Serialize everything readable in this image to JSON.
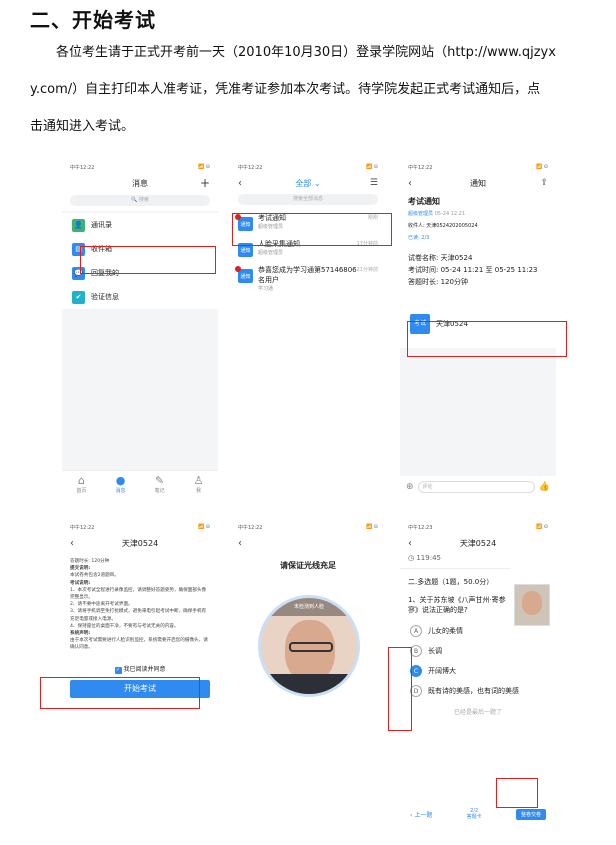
{
  "heading": "二、开始考试",
  "paragraph": {
    "line1": "各位考生请于正式开考前一天（2010年10月30日）登录学院网站（http://www.qjzyx",
    "line2": "y.com/）自主打印本人准考证，凭准考证参加本次考试。待学院发起正式考试通知后，点",
    "line3": "击通知进入考试。"
  },
  "time_a": "中午12:22",
  "time_b": "中午12:23",
  "status_icons": "📶 ⊙",
  "s1": {
    "title": "消息",
    "plus": "+",
    "search": "搜索",
    "items": [
      {
        "label": "通讯录",
        "icon": "👤",
        "color": "#3cb371"
      },
      {
        "label": "收件箱",
        "icon": "▤",
        "color": "#2f8bf0"
      },
      {
        "label": "回复我的",
        "icon": "💬",
        "color": "#2f8bf0"
      },
      {
        "label": "验证信息",
        "icon": "✔",
        "color": "#20b2c8"
      }
    ],
    "tabs": [
      "首页",
      "消息",
      "笔记",
      "我"
    ]
  },
  "s2": {
    "filter": "全部 ⌄",
    "search": "搜索全部消息",
    "badge": "通知",
    "messages": [
      {
        "title": "考试通知",
        "sub": "超级管理员",
        "time": "刚刚",
        "dot": true
      },
      {
        "title": "人脸采集通知",
        "sub": "超级管理员",
        "time": "17分钟前",
        "dot": false
      },
      {
        "title": "恭喜您成为学习通第57146806名用户",
        "sub": "学习通",
        "time": "21分钟前",
        "dot": true
      }
    ]
  },
  "s3": {
    "title": "通知",
    "heading": "考试通知",
    "sender": "超级管理员",
    "sender_date": "05-24 12:21",
    "recipient": "收件人: 天津0524202005024",
    "read": "已读: 2/3",
    "exam_name": "试卷名称: 天津0524",
    "exam_time": "考试时间: 05-24 11:21 至 05-25 11:23",
    "exam_duration": "答题时长: 120分钟",
    "card_badge": "考试",
    "card_text": "天津0524",
    "comment": "评论"
  },
  "s4": {
    "title": "天津0524",
    "lines": [
      "答题时长: 120分钟",
      "提交说明:",
      "本试卷共包含2道题目。",
      "考试说明:",
      "1、本次考试全程进行录像监控，请调整好答题姿势，确保面部头像完整显示。",
      "2、请不要中途离开考试界面。",
      "3、请将手机调至免打扰模式，避免来电引起考试中断，确保手机有充足电量或接入电源。",
      "4、保持座位的桌面干净，不要有与考试无关的内容。",
      "系统声明:",
      "由于本次考试需要进行人脸识别监控，系统需要开启您的摄像头，请确认同意。"
    ],
    "agree": "我已阅读并同意",
    "start": "开始考试"
  },
  "s5": {
    "heading": "请保证光线充足",
    "face_hint": "未检测到人脸"
  },
  "s6": {
    "title": "天津0524",
    "timer": "119:45",
    "section": "二.多选题（1题，50.0分）",
    "question": "1、关于苏东坡《八声甘州·寄参寥》说法正确的是?",
    "options": [
      {
        "k": "A",
        "t": "儿女的柔情"
      },
      {
        "k": "B",
        "t": "长调"
      },
      {
        "k": "C",
        "t": "开阔博大"
      },
      {
        "k": "D",
        "t": "既有诗的美感，也有词的美感"
      }
    ],
    "last_hint": "已经是最后一题了",
    "prev": "上一题",
    "page": "2/2",
    "sheet": "答题卡",
    "submit": "整卷交卷"
  }
}
